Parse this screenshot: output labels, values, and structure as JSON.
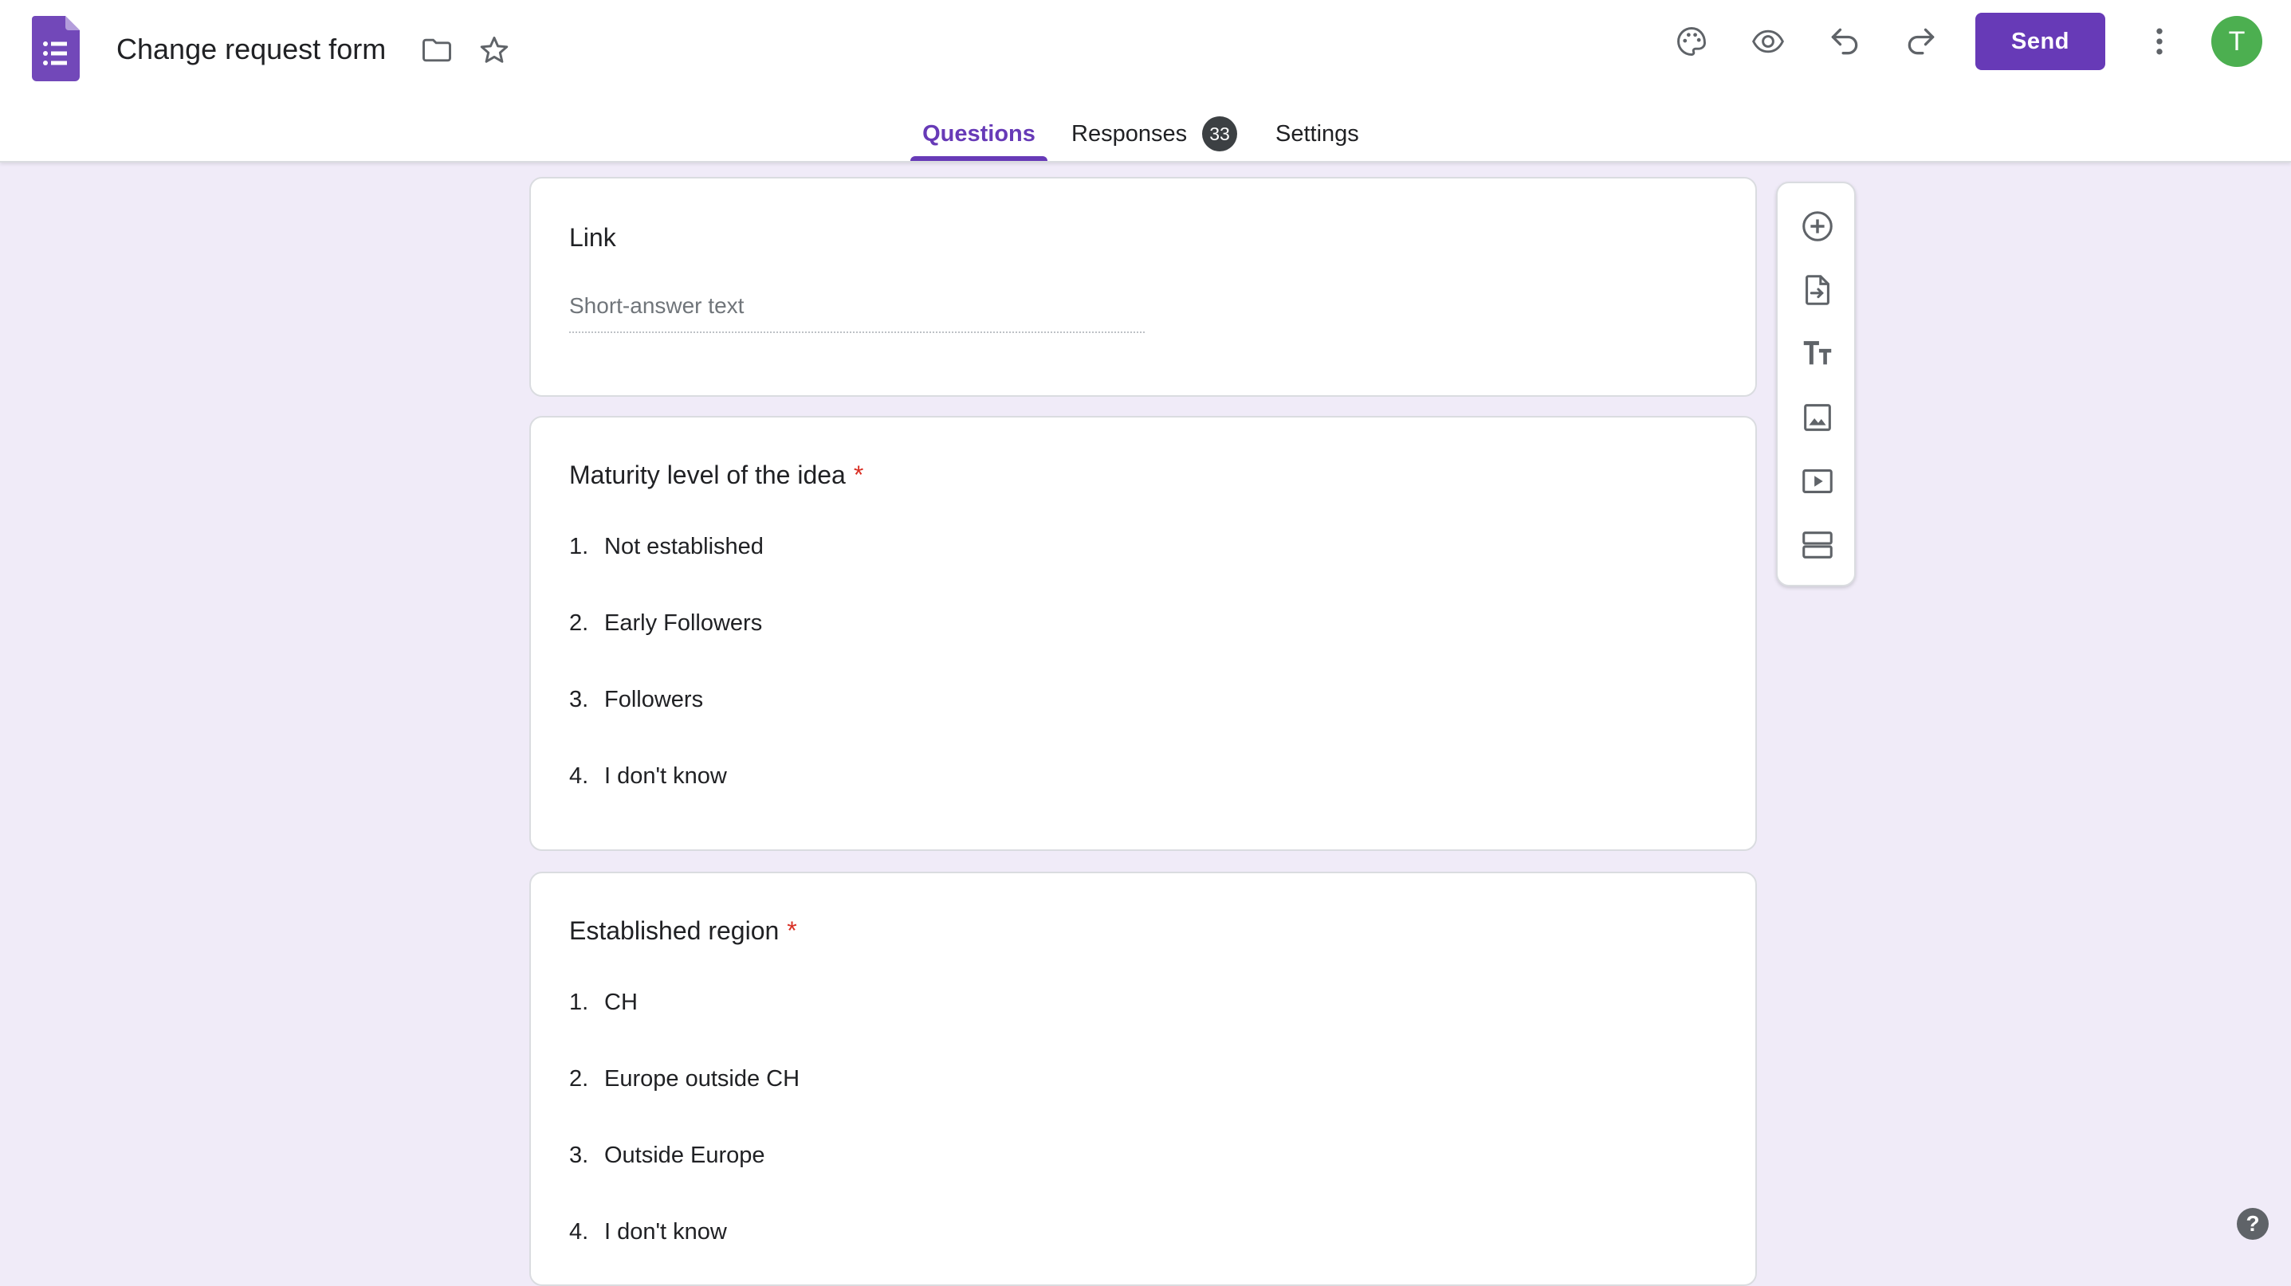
{
  "header": {
    "title": "Change request form",
    "send_label": "Send",
    "avatar_initial": "T",
    "brand_color": "#673ab7"
  },
  "tabs": [
    {
      "label": "Questions",
      "active": true
    },
    {
      "label": "Responses",
      "badge": "33"
    },
    {
      "label": "Settings"
    }
  ],
  "questions": [
    {
      "title": "Link",
      "type": "short-answer",
      "placeholder": "Short-answer text"
    },
    {
      "title": "Maturity level of the idea",
      "required": "*",
      "options": [
        {
          "num": "1.",
          "label": "Not established"
        },
        {
          "num": "2.",
          "label": "Early Followers"
        },
        {
          "num": "3.",
          "label": "Followers"
        },
        {
          "num": "4.",
          "label": "I don't know"
        }
      ]
    },
    {
      "title": "Established region",
      "required": "*",
      "options": [
        {
          "num": "1.",
          "label": "CH"
        },
        {
          "num": "2.",
          "label": "Europe outside CH"
        },
        {
          "num": "3.",
          "label": "Outside Europe"
        },
        {
          "num": "4.",
          "label": "I don't know"
        }
      ]
    }
  ],
  "toolbar_icons": [
    "add-question-icon",
    "import-questions-icon",
    "add-title-icon",
    "add-image-icon",
    "add-video-icon",
    "add-section-icon"
  ],
  "help": "?"
}
